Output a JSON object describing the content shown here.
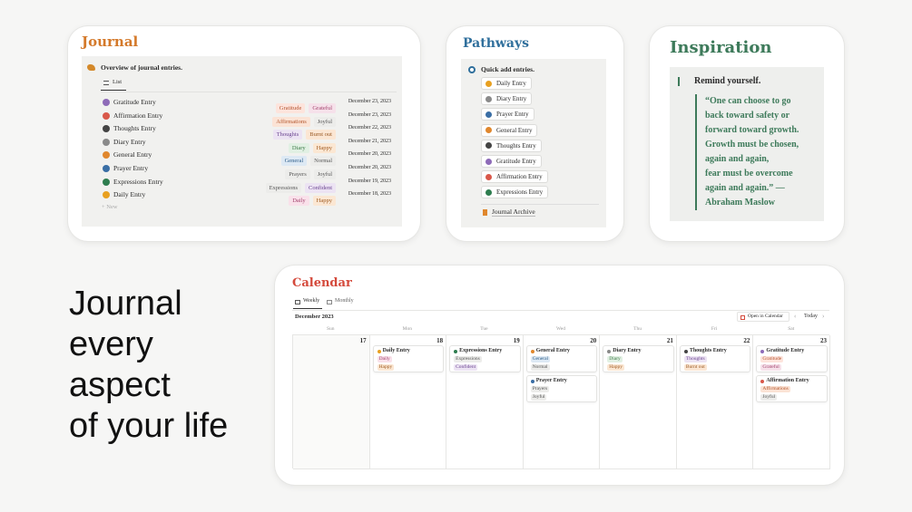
{
  "journal": {
    "title": "Journal",
    "overview": "Overview of journal entries.",
    "view_tab": "List",
    "new_label": "New",
    "entries": [
      {
        "name": "Gratitude Entry",
        "icon": "gratitude-icon",
        "ic": "#8e6bb8",
        "tags": [
          {
            "t": "Gratitude",
            "bg": "#fde4dc",
            "fg": "#b5532f"
          },
          {
            "t": "Grateful",
            "bg": "#f6e1ea",
            "fg": "#a3426d"
          }
        ],
        "date": "December 23, 2023"
      },
      {
        "name": "Affirmation Entry",
        "icon": "affirmation-icon",
        "ic": "#d9584a",
        "tags": [
          {
            "t": "Affirmations",
            "bg": "#fbe3d5",
            "fg": "#b2542a"
          },
          {
            "t": "Joyful",
            "bg": "#ececea",
            "fg": "#555"
          }
        ],
        "date": "December 23, 2023"
      },
      {
        "name": "Thoughts Entry",
        "icon": "thoughts-icon",
        "ic": "#444",
        "tags": [
          {
            "t": "Thoughts",
            "bg": "#ece3f3",
            "fg": "#6b4591"
          },
          {
            "t": "Burnt out",
            "bg": "#fbe6d3",
            "fg": "#9a5a25"
          }
        ],
        "date": "December 22, 2023"
      },
      {
        "name": "Diary Entry",
        "icon": "diary-icon",
        "ic": "#8a8a8a",
        "tags": [
          {
            "t": "Diary",
            "bg": "#e1f0e3",
            "fg": "#3c7a47"
          },
          {
            "t": "Happy",
            "bg": "#fbe7d3",
            "fg": "#a05b22"
          }
        ],
        "date": "December 21, 2023"
      },
      {
        "name": "General Entry",
        "icon": "general-icon",
        "ic": "#e0872d",
        "tags": [
          {
            "t": "General",
            "bg": "#dde9f4",
            "fg": "#2f5f8a"
          },
          {
            "t": "Normal",
            "bg": "#ececea",
            "fg": "#555"
          }
        ],
        "date": "December 20, 2023"
      },
      {
        "name": "Prayer Entry",
        "icon": "prayer-icon",
        "ic": "#3a6ea5",
        "tags": [
          {
            "t": "Prayers",
            "bg": "#ececea",
            "fg": "#555"
          },
          {
            "t": "Joyful",
            "bg": "#ececea",
            "fg": "#555"
          }
        ],
        "date": "December 20, 2023"
      },
      {
        "name": "Expressions Entry",
        "icon": "expressions-icon",
        "ic": "#2e7d4f",
        "tags": [
          {
            "t": "Expressions",
            "bg": "#ececea",
            "fg": "#555"
          },
          {
            "t": "Confident",
            "bg": "#ece3f3",
            "fg": "#6b4591"
          }
        ],
        "date": "December 19, 2023"
      },
      {
        "name": "Daily Entry",
        "icon": "daily-icon",
        "ic": "#e8a020",
        "tags": [
          {
            "t": "Daily",
            "bg": "#f9e1ea",
            "fg": "#a3426d"
          },
          {
            "t": "Happy",
            "bg": "#fbe7d3",
            "fg": "#a05b22"
          }
        ],
        "date": "December 18, 2023"
      }
    ]
  },
  "pathways": {
    "title": "Pathways",
    "quick_add": "Quick add entries.",
    "archive": "Journal Archive",
    "items": [
      {
        "label": "Daily Entry",
        "icon": "sun-icon",
        "ic": "#e8a020"
      },
      {
        "label": "Diary Entry",
        "icon": "book-icon",
        "ic": "#8a8a8a"
      },
      {
        "label": "Prayer Entry",
        "icon": "cloud-icon",
        "ic": "#3a6ea5"
      },
      {
        "label": "General Entry",
        "icon": "bookmark-icon",
        "ic": "#e0872d"
      },
      {
        "label": "Thoughts Entry",
        "icon": "brain-icon",
        "ic": "#444"
      },
      {
        "label": "Gratitude Entry",
        "icon": "smile-icon",
        "ic": "#8e6bb8"
      },
      {
        "label": "Affirmation Entry",
        "icon": "lotus-icon",
        "ic": "#d9584a"
      },
      {
        "label": "Expressions Entry",
        "icon": "chat-icon",
        "ic": "#2e7d4f"
      }
    ]
  },
  "inspiration": {
    "title": "Inspiration",
    "heading": "Remind yourself.",
    "quote_lines": [
      "“One can choose to go",
      "back toward safety or",
      "forward toward growth.",
      "Growth must be chosen,",
      "again and again,",
      "fear must be overcome",
      "again and again.” —",
      "Abraham Maslow"
    ]
  },
  "headline": [
    "Journal",
    "every",
    "aspect",
    "of your life"
  ],
  "calendar": {
    "title": "Calendar",
    "tab_weekly": "Weekly",
    "tab_monthly": "Monthly",
    "month": "December 2023",
    "open_in": "Open in Calendar",
    "today": "Today",
    "weekdays": [
      "Sun",
      "Mon",
      "Tue",
      "Wed",
      "Thu",
      "Fri",
      "Sat"
    ],
    "days": [
      "17",
      "18",
      "19",
      "20",
      "21",
      "22",
      "23"
    ],
    "events": [
      {
        "day": 1,
        "slot": 0,
        "title": "Daily Entry",
        "ic": "#e8a020",
        "tags": [
          {
            "t": "Daily",
            "bg": "#f9e1ea",
            "fg": "#a3426d"
          },
          {
            "t": "Happy",
            "bg": "#fbe7d3",
            "fg": "#a05b22"
          }
        ]
      },
      {
        "day": 2,
        "slot": 0,
        "title": "Expressions Entry",
        "ic": "#2e7d4f",
        "tags": [
          {
            "t": "Expressions",
            "bg": "#ececea",
            "fg": "#555"
          },
          {
            "t": "Confident",
            "bg": "#ece3f3",
            "fg": "#6b4591"
          }
        ]
      },
      {
        "day": 3,
        "slot": 0,
        "title": "General Entry",
        "ic": "#e0872d",
        "tags": [
          {
            "t": "General",
            "bg": "#dde9f4",
            "fg": "#2f5f8a"
          },
          {
            "t": "Normal",
            "bg": "#ececea",
            "fg": "#555"
          }
        ]
      },
      {
        "day": 3,
        "slot": 1,
        "title": "Prayer Entry",
        "ic": "#3a6ea5",
        "tags": [
          {
            "t": "Prayers",
            "bg": "#ececea",
            "fg": "#555"
          },
          {
            "t": "Joyful",
            "bg": "#ececea",
            "fg": "#555"
          }
        ]
      },
      {
        "day": 4,
        "slot": 0,
        "title": "Diary Entry",
        "ic": "#8a8a8a",
        "tags": [
          {
            "t": "Diary",
            "bg": "#e1f0e3",
            "fg": "#3c7a47"
          },
          {
            "t": "Happy",
            "bg": "#fbe7d3",
            "fg": "#a05b22"
          }
        ]
      },
      {
        "day": 5,
        "slot": 0,
        "title": "Thoughts Entry",
        "ic": "#444",
        "tags": [
          {
            "t": "Thoughts",
            "bg": "#ece3f3",
            "fg": "#6b4591"
          },
          {
            "t": "Burnt out",
            "bg": "#fbe6d3",
            "fg": "#9a5a25"
          }
        ]
      },
      {
        "day": 6,
        "slot": 0,
        "title": "Gratitude Entry",
        "ic": "#8e6bb8",
        "tags": [
          {
            "t": "Gratitude",
            "bg": "#fde4dc",
            "fg": "#b5532f"
          },
          {
            "t": "Grateful",
            "bg": "#f6e1ea",
            "fg": "#a3426d"
          }
        ]
      },
      {
        "day": 6,
        "slot": 1,
        "title": "Affirmation Entry",
        "ic": "#d9584a",
        "tags": [
          {
            "t": "Affirmations",
            "bg": "#fbe3d5",
            "fg": "#b2542a"
          },
          {
            "t": "Joyful",
            "bg": "#ececea",
            "fg": "#555"
          }
        ]
      }
    ]
  },
  "colors": {
    "journal": "#d4792a",
    "pathways": "#2f6f9c",
    "inspiration": "#3d7a5a",
    "calendar": "#d4493b"
  }
}
